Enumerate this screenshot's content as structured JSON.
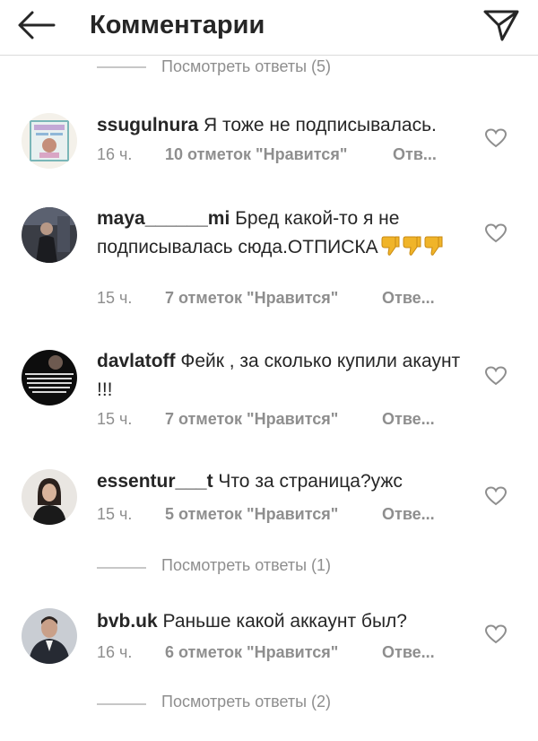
{
  "header": {
    "title": "Комментарии"
  },
  "replies": [
    {
      "label": "Посмотреть ответы (5)"
    },
    {
      "label": "Посмотреть ответы (1)"
    },
    {
      "label": "Посмотреть ответы (2)"
    }
  ],
  "comments": [
    {
      "username": "ssugulnura",
      "text": "Я тоже не подписывалась.",
      "time": "16 ч.",
      "likes": "10 отметок \"Нравится\"",
      "reply": "Отв..."
    },
    {
      "username": "maya______mi",
      "text": "Бред какой-то я не подписывалась сюда.ОТПИСКА",
      "emoji": [
        "thumbs-down",
        "thumbs-down",
        "thumbs-down"
      ],
      "time": "15 ч.",
      "likes": "7 отметок \"Нравится\"",
      "reply": "Отве..."
    },
    {
      "username": "davlatoff",
      "text": "Фейк , за сколько купили акаунт !!!",
      "time": "15 ч.",
      "likes": "7 отметок \"Нравится\"",
      "reply": "Отве..."
    },
    {
      "username": "essentur___t",
      "text": "Что за страница?ужс",
      "time": "15 ч.",
      "likes": "5 отметок \"Нравится\"",
      "reply": "Отве..."
    },
    {
      "username": "bvb.uk",
      "text": "Раньше какой аккаунт был?",
      "time": "16 ч.",
      "likes": "6 отметок \"Нравится\"",
      "reply": "Отве..."
    }
  ],
  "colors": {
    "text": "#262626",
    "muted": "#8e8e8e",
    "divider": "#c7c7c7",
    "emoji": "#f0b429"
  }
}
